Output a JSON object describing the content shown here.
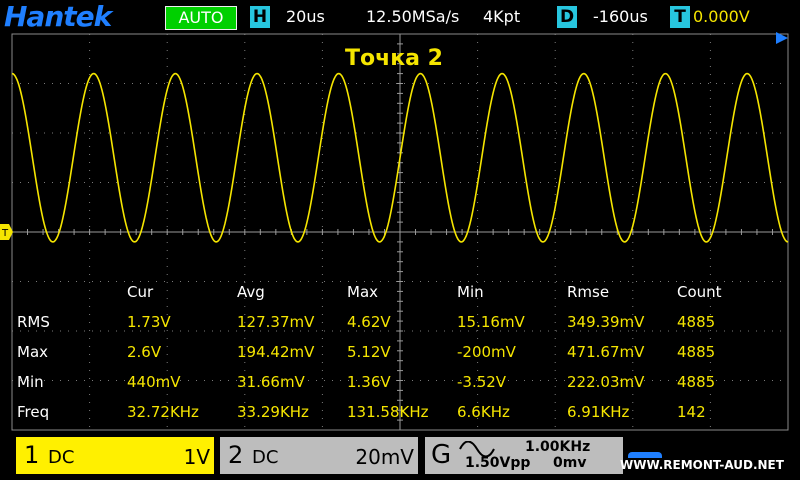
{
  "header": {
    "brand": "Hantek",
    "mode": "AUTO",
    "h_badge": "H",
    "timebase": "20us",
    "sample_rate": "12.50MSa/s",
    "memory_depth": "4Kpt",
    "d_badge": "D",
    "delay": "-160us",
    "t_badge": "T",
    "trigger_level": "0.000V"
  },
  "screen_title": "Точка 2",
  "markers": {
    "trigger_marker": "T"
  },
  "waveform": {
    "color": "#f5e500",
    "cycles_on_screen": 9.5,
    "high_div": -3.2,
    "low_div": 0.2
  },
  "measurements": {
    "columns": [
      "Cur",
      "Avg",
      "Max",
      "Min",
      "Rmse",
      "Count"
    ],
    "rows": [
      {
        "name": "RMS",
        "values": [
          "1.73V",
          "127.37mV",
          "4.62V",
          "15.16mV",
          "349.39mV",
          "4885"
        ]
      },
      {
        "name": "Max",
        "values": [
          "2.6V",
          "194.42mV",
          "5.12V",
          "-200mV",
          "471.67mV",
          "4885"
        ]
      },
      {
        "name": "Min",
        "values": [
          "440mV",
          "31.66mV",
          "1.36V",
          "-3.52V",
          "222.03mV",
          "4885"
        ]
      },
      {
        "name": "Freq",
        "values": [
          "32.72KHz",
          "33.29KHz",
          "131.58KHz",
          "6.6KHz",
          "6.91KHz",
          "142"
        ]
      }
    ]
  },
  "channel1": {
    "number": "1",
    "coupling": "DC",
    "scale": "1V",
    "color": "#fff000"
  },
  "channel2": {
    "number": "2",
    "coupling": "DC",
    "scale": "20mV"
  },
  "generator": {
    "label": "G",
    "waveform_icon": "sine-wave-icon",
    "frequency": "1.00KHz",
    "amplitude": "1.50Vpp",
    "offset": "0mv"
  },
  "watermark": "WWW.REMONT-AUD.NET"
}
